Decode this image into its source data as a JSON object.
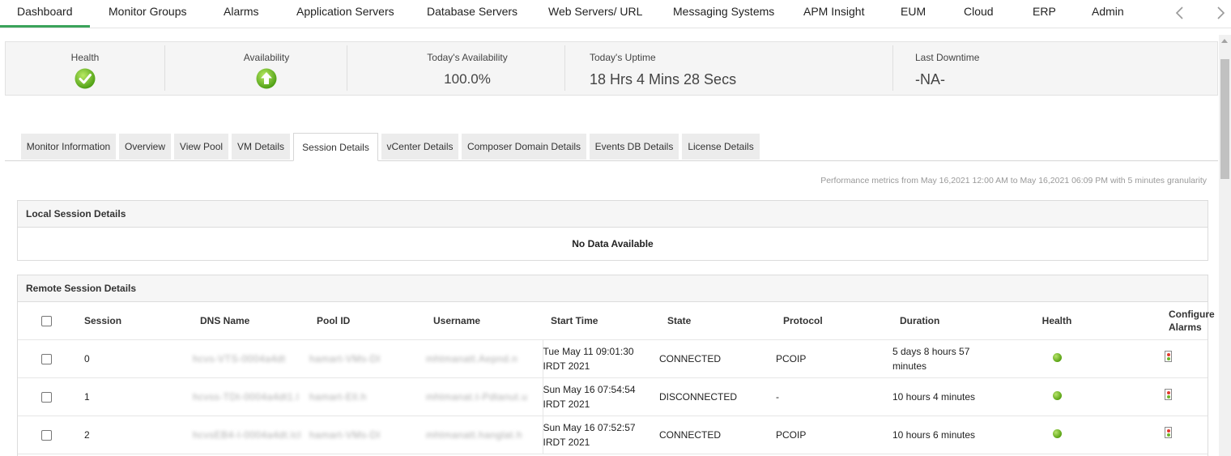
{
  "nav": {
    "items": [
      "Dashboard",
      "Monitor Groups",
      "Alarms",
      "Application Servers",
      "Database Servers",
      "Web Servers/ URL",
      "Messaging Systems",
      "APM Insight",
      "EUM",
      "Cloud",
      "ERP",
      "Admin"
    ],
    "active": "Dashboard"
  },
  "summary": {
    "health_label": "Health",
    "availability_label": "Availability",
    "todays_availability_label": "Today's Availability",
    "todays_availability_value": "100.0%",
    "todays_uptime_label": "Today's Uptime",
    "todays_uptime_value": "18 Hrs 4 Mins 28 Secs",
    "last_downtime_label": "Last Downtime",
    "last_downtime_value": "-NA-"
  },
  "tabs": [
    "Monitor Information",
    "Overview",
    "View Pool",
    "VM Details",
    "Session Details",
    "vCenter Details",
    "Composer Domain Details",
    "Events DB Details",
    "License Details"
  ],
  "active_tab": "Session Details",
  "perf_note": "Performance metrics from May 16,2021 12:00 AM to May 16,2021 06:09 PM with 5 minutes granularity",
  "local_sessions": {
    "title": "Local Session Details",
    "empty_text": "No Data Available"
  },
  "remote_sessions": {
    "title": "Remote Session Details",
    "columns": {
      "session": "Session",
      "dns_name": "DNS Name",
      "pool_id": "Pool ID",
      "username": "Username",
      "start_time": "Start Time",
      "state": "State",
      "protocol": "Protocol",
      "duration": "Duration",
      "health": "Health",
      "configure_alarms": "Configure Alarms"
    },
    "rows": [
      {
        "session": "0",
        "dns_name": "hcvs-VTS-0004a4dt",
        "pool_id": "hamart-VMs-DI",
        "username": "mhtmanatt.Aepnd.n",
        "start_time": "Tue May 11 09:01:30 IRDT 2021",
        "state": "CONNECTED",
        "protocol": "PCOIP",
        "duration": "5 days 8 hours 57 minutes",
        "health": "healthy"
      },
      {
        "session": "1",
        "dns_name": "hcvss-TDt-0004a4dt1.l",
        "pool_id": "hamart-Ell.h",
        "username": "mhtmanat.t-Pdtanut.u",
        "start_time": "Sun May 16 07:54:54 IRDT 2021",
        "state": "DISCONNECTED",
        "protocol": "-",
        "duration": "10 hours 4 minutes",
        "health": "healthy"
      },
      {
        "session": "2",
        "dns_name": "hcvsEB4-l-0004a4dt.lcl",
        "pool_id": "hamart-VMs-DI",
        "username": "mhtmanatt.hanglat.h",
        "start_time": "Sun May 16 07:52:57 IRDT 2021",
        "state": "CONNECTED",
        "protocol": "PCOIP",
        "duration": "10 hours 6 minutes",
        "health": "healthy"
      }
    ]
  },
  "colors": {
    "accent_green": "#3aa35a",
    "health_green": "#6cc12b"
  }
}
